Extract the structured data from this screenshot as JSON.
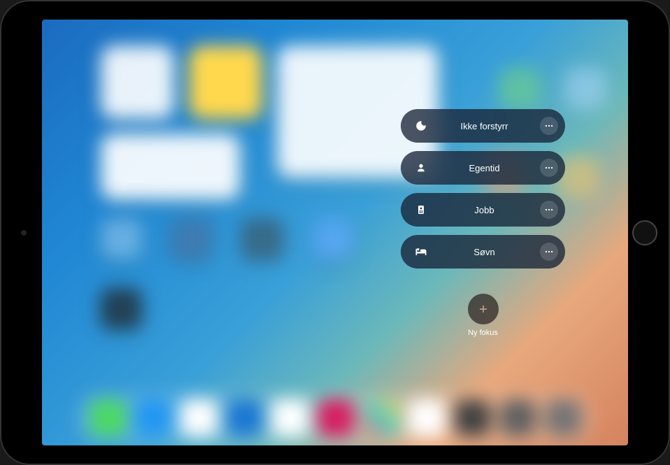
{
  "focus": {
    "items": [
      {
        "id": "do-not-disturb",
        "icon": "moon",
        "label": "Ikke forstyrr"
      },
      {
        "id": "personal",
        "icon": "person",
        "label": "Egentid"
      },
      {
        "id": "work",
        "icon": "badge",
        "label": "Jobb"
      },
      {
        "id": "sleep",
        "icon": "bed",
        "label": "Søvn"
      }
    ],
    "new_focus_label": "Ny fokus"
  },
  "colors": {
    "pill_bg": "rgba(20, 30, 50, 0.75)",
    "text": "#ffffff"
  }
}
